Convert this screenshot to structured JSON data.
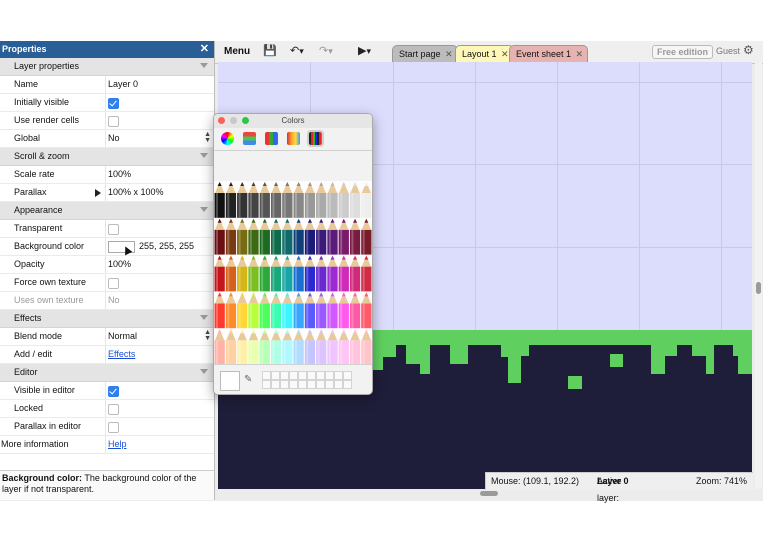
{
  "properties": {
    "title": "Properties",
    "close_glyph": "✕",
    "sections": {
      "layer": "Layer properties",
      "scroll": "Scroll & zoom",
      "appearance": "Appearance",
      "effects": "Effects",
      "editor": "Editor"
    },
    "rows": {
      "name": {
        "label": "Name",
        "value": "Layer 0"
      },
      "initially_visible": {
        "label": "Initially visible",
        "checked": true
      },
      "use_render_cells": {
        "label": "Use render cells",
        "checked": false
      },
      "global": {
        "label": "Global",
        "value": "No"
      },
      "scale_rate": {
        "label": "Scale rate",
        "value": "100%"
      },
      "parallax": {
        "label": "Parallax",
        "value": "100% x 100%"
      },
      "transparent": {
        "label": "Transparent",
        "checked": false
      },
      "background_color": {
        "label": "Background color",
        "value": "255, 255, 255",
        "swatch": "#ffffff"
      },
      "opacity": {
        "label": "Opacity",
        "value": "100%"
      },
      "force_own_texture": {
        "label": "Force own texture",
        "checked": false
      },
      "uses_own_texture": {
        "label": "Uses own texture",
        "value": "No"
      },
      "blend_mode": {
        "label": "Blend mode",
        "value": "Normal"
      },
      "add_edit": {
        "label": "Add / edit",
        "value": "Effects"
      },
      "visible_in_editor": {
        "label": "Visible in editor",
        "checked": true
      },
      "locked": {
        "label": "Locked",
        "checked": false
      },
      "parallax_in_editor": {
        "label": "Parallax in editor",
        "checked": false
      },
      "more_info": {
        "label": "More information",
        "value": "Help"
      }
    },
    "help": {
      "term": "Background color:",
      "text": " The background color of the layer if not transparent."
    }
  },
  "toolbar": {
    "menu_label": "Menu",
    "save_icon": "floppy-disk-icon",
    "undo_icon": "undo-icon",
    "redo_icon": "redo-icon",
    "play_icon": "play-icon",
    "free_edition": "Free edition",
    "user": "Guest",
    "tabs": [
      {
        "label": "Start page",
        "state": "inactive"
      },
      {
        "label": "Layout 1",
        "state": "active"
      },
      {
        "label": "Event sheet 1",
        "state": "event"
      }
    ]
  },
  "colors_window": {
    "title": "Colors",
    "pencil_colors": [
      [
        "#111111",
        "#222222",
        "#333333",
        "#444444",
        "#555555",
        "#666666",
        "#777777",
        "#888888",
        "#999999",
        "#aaaaaa",
        "#bbbbbb",
        "#cccccc",
        "#dddddd",
        "#eeeeee"
      ],
      [
        "#6b0f14",
        "#7a3a12",
        "#7a6a10",
        "#3d6b14",
        "#1d6b20",
        "#0f6b4a",
        "#0f6b6b",
        "#113f7a",
        "#1b1b7a",
        "#3a1b7a",
        "#5a1b7a",
        "#7a1b6a",
        "#7a1b42",
        "#7a1b2a"
      ],
      [
        "#c4161c",
        "#d4621a",
        "#d6b516",
        "#7bbf22",
        "#2fa83a",
        "#18a87a",
        "#16a6a6",
        "#1a6fd0",
        "#2a2ad0",
        "#6a2ad0",
        "#9b2ad0",
        "#d02ab8",
        "#d02a7a",
        "#d02a44"
      ],
      [
        "#ff3b30",
        "#ff8a2a",
        "#ffd633",
        "#b6ff3a",
        "#4cff5a",
        "#3affb0",
        "#3af6ff",
        "#3aa6ff",
        "#5a5aff",
        "#9a5aff",
        "#d05aff",
        "#ff5af0",
        "#ff5aa6",
        "#ff5a6a"
      ],
      [
        "#ffb3a8",
        "#ffd0a0",
        "#fff0a8",
        "#e8ffb0",
        "#b8ffb8",
        "#b0ffe4",
        "#b0f8ff",
        "#b0dcff",
        "#c4c4ff",
        "#dcc4ff",
        "#f0c4ff",
        "#ffc4f6",
        "#ffc4dc",
        "#ffc4c8"
      ]
    ]
  },
  "status": {
    "mouse": "Mouse: (109.1, 192.2)",
    "active_layer_label": "Active layer: ",
    "active_layer_value": "Layer 0",
    "zoom": "Zoom: 741%"
  },
  "colors": {
    "title_bar": "#2a5e96",
    "canvas_bg": "#dcdcfc",
    "ground": "#1f1e3a",
    "grass": "#5fd05f",
    "link": "#1a4fd6",
    "checkbox_on": "#2f7ff0"
  }
}
